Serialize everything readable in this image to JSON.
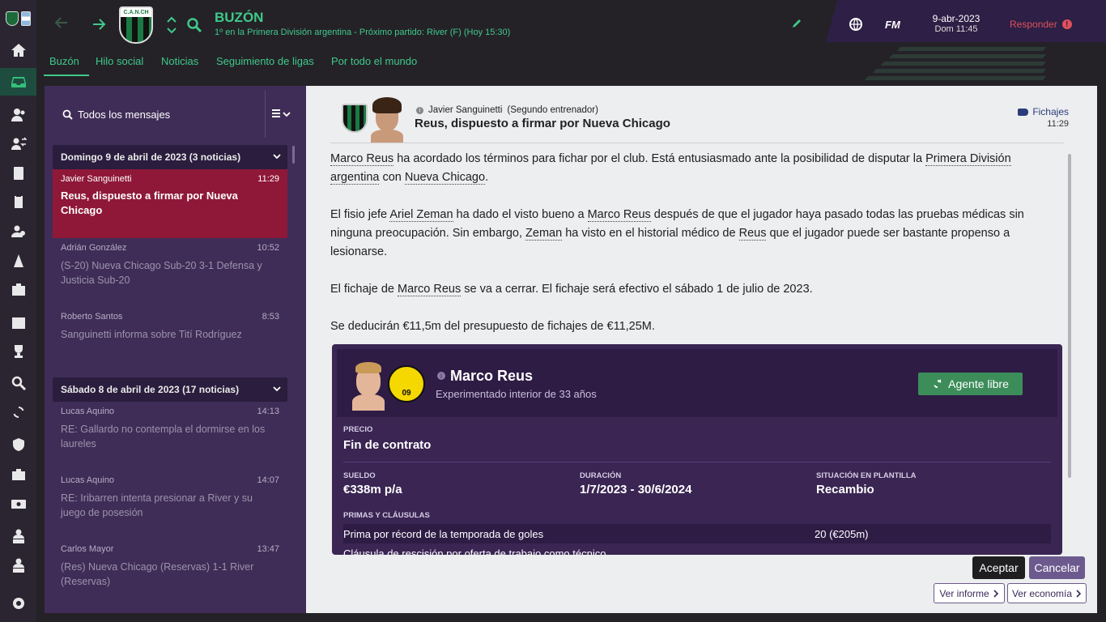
{
  "topbar": {
    "title": "BUZÓN",
    "subtitle": "1º en la Primera División argentina - Próximo partido: River (F)  (Hoy 15:30)",
    "date": "9-abr-2023",
    "day_time": "Dom 11:45",
    "fm_label": "FM",
    "respond_label": "Responder",
    "crest_text": "C.A.N.CH"
  },
  "tabs": [
    "Buzón",
    "Hilo social",
    "Noticias",
    "Seguimiento de ligas",
    "Por todo el mundo"
  ],
  "inbox": {
    "filter_label": "Todos los mensajes",
    "groups": [
      {
        "label": "Domingo 9 de abril de 2023 (3 noticias)"
      },
      {
        "label": "Sábado 8 de abril de 2023 (17 noticias)"
      }
    ],
    "messages": [
      {
        "sender": "Javier Sanguinetti",
        "time": "11:29",
        "subject": "Reus, dispuesto a firmar por Nueva Chicago"
      },
      {
        "sender": "Adrián González",
        "time": "10:52",
        "subject": "(S-20) Nueva Chicago Sub-20 3-1 Defensa y Justicia Sub-20"
      },
      {
        "sender": "Roberto Santos",
        "time": "8:53",
        "subject": "Sanguinetti informa sobre Tití Rodríguez"
      },
      {
        "sender": "Lucas Aquino",
        "time": "14:13",
        "subject": "RE: Gallardo no contempla el dormirse en los laureles"
      },
      {
        "sender": "Lucas Aquino",
        "time": "14:07",
        "subject": "RE: Iribarren intenta presionar a River y su juego de posesión"
      },
      {
        "sender": "Carlos Mayor",
        "time": "13:47",
        "subject": "(Res) Nueva Chicago (Reservas) 1-1 River (Reservas)"
      }
    ]
  },
  "message": {
    "sender": "Javier Sanguinetti",
    "role": "(Segundo entrenador)",
    "subject": "Reus, dispuesto a firmar por Nueva Chicago",
    "tag": "Fichajes",
    "time": "11:29",
    "p1": {
      "a": "Marco Reus",
      "b": " ha acordado los términos para fichar por el club. Está entusiasmado ante la posibilidad de disputar la ",
      "c": "Primera División argentina",
      "d": " con ",
      "e": "Nueva Chicago",
      "f": "."
    },
    "p2": {
      "a": "El fisio jefe ",
      "b": "Ariel Zeman",
      "c": " ha dado el visto bueno a ",
      "d": "Marco Reus",
      "e": " después de que el jugador haya pasado todas las pruebas médicas sin ninguna preocupación. Sin embargo, ",
      "f": "Zeman",
      "g": " ha visto en el historial médico de ",
      "h": "Reus",
      "i": " que el jugador puede ser bastante propenso a lesionarse."
    },
    "p3": {
      "a": "El fichaje de ",
      "b": "Marco Reus",
      "c": " se va a cerrar. El fichaje será efectivo el sábado 1 de julio de 2023."
    },
    "p4": "Se deducirán €11,5m del presupuesto de fichajes de €11,25M."
  },
  "contract": {
    "player_name": "Marco Reus",
    "player_desc": "Experimentado interior de 33 años",
    "club_badge_text": "09",
    "status_button": "Agente libre",
    "price_label": "PRECIO",
    "price_value": "Fin de contrato",
    "salary_label": "SUELDO",
    "salary_value": "€338m p/a",
    "duration_label": "DURACIÓN",
    "duration_value": "1/7/2023 - 30/6/2024",
    "squad_label": "SITUACIÓN EN PLANTILLA",
    "squad_value": "Recambio",
    "bonuses_label": "PRIMAS Y CLÁUSULAS",
    "bonus_rows": [
      {
        "name": "Prima por récord de la temporada de goles",
        "value": "20 (€205m)"
      },
      {
        "name": "Cláusula de rescisión por oferta de trabajo como técnico",
        "value": ""
      }
    ]
  },
  "actions": {
    "accept": "Aceptar",
    "cancel": "Cancelar",
    "report": "Ver informe",
    "economy": "Ver economía"
  },
  "colors": {
    "accent_green": "#3fc98a",
    "selected_message": "#8f1838",
    "panel_purple": "#3f2d57",
    "respond_red": "#e0505b"
  }
}
